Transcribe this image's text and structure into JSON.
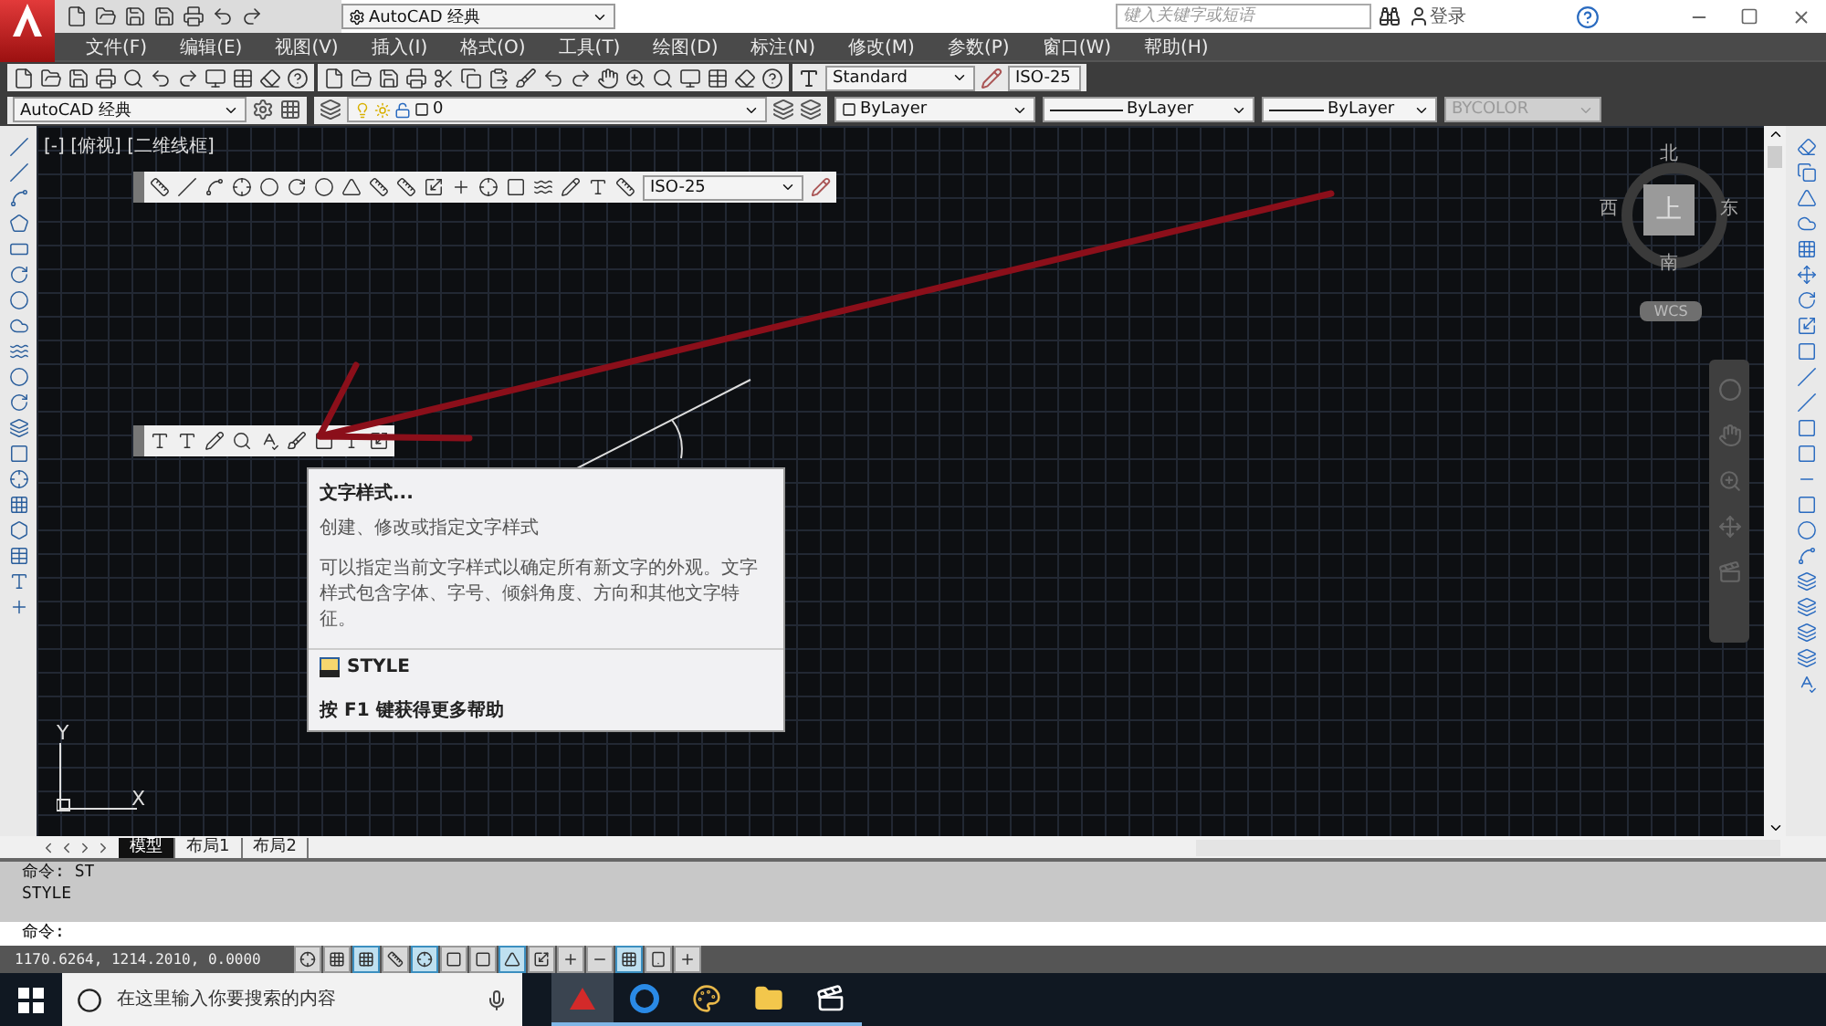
{
  "title_bar": {
    "workspace": "AutoCAD 经典",
    "search_placeholder": "键入关键字或短语",
    "sign_in": "登录"
  },
  "menu": [
    "文件(F)",
    "编辑(E)",
    "视图(V)",
    "插入(I)",
    "格式(O)",
    "工具(T)",
    "绘图(D)",
    "标注(N)",
    "修改(M)",
    "参数(P)",
    "窗口(W)",
    "帮助(H)"
  ],
  "styles_toolbar": {
    "text_style": "Standard",
    "dim_style": "ISO-25"
  },
  "properties_bar": {
    "workspace": "AutoCAD 经典",
    "layer": "0",
    "color_setting": "ByLayer",
    "linetype": "ByLayer",
    "lineweight": "ByLayer",
    "plot_style": {
      "label": "BYCOLOR",
      "disabled": true
    }
  },
  "viewport_label": "[-] [俯视] [二维线框]",
  "dimension_toolbar": {
    "dim_style": "ISO-25"
  },
  "tooltip": {
    "title": "文字样式...",
    "summary": "创建、修改或指定文字样式",
    "description": "可以指定当前文字样式以确定所有新文字的外观。文字样式包含字体、字号、倾斜角度、方向和其他文字特征。",
    "command": "STYLE",
    "help": "按 F1 键获得更多帮助"
  },
  "view_cube": {
    "north": "北",
    "west": "西",
    "top": "上",
    "east": "东",
    "south": "南",
    "ucs": "WCS"
  },
  "ucs_icon": {
    "y": "Y",
    "x": "X"
  },
  "layout_tabs": [
    {
      "label": "模型",
      "selected": true
    },
    {
      "label": "布局1",
      "selected": false
    },
    {
      "label": "布局2",
      "selected": false
    }
  ],
  "command_history": [
    "命令: ST",
    "STYLE"
  ],
  "command_prompt": "命令:",
  "status_bar": {
    "coordinates": "1170.6264, 1214.2010, 0.0000",
    "toggles": [
      {
        "on": false
      },
      {
        "on": false
      },
      {
        "on": true
      },
      {
        "on": false
      },
      {
        "on": true
      },
      {
        "on": false
      },
      {
        "on": false
      },
      {
        "on": true
      },
      {
        "on": false
      },
      {
        "on": false
      },
      {
        "on": false
      },
      {
        "on": true
      },
      {
        "on": false
      },
      {
        "on": false
      }
    ]
  },
  "taskbar": {
    "search_placeholder": "在这里输入你要搜索的内容"
  }
}
